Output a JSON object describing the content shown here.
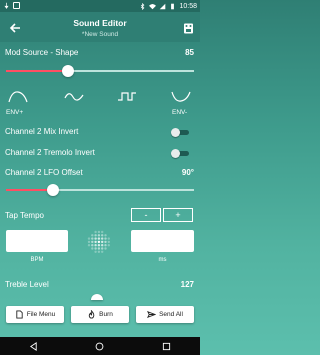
{
  "status_bar": {
    "time": "10:58"
  },
  "header": {
    "title": "Sound Editor",
    "subtitle": "*New Sound",
    "back_icon": "arrow-left-icon",
    "app_icon": "pedal-icon"
  },
  "mod_source": {
    "label": "Mod Source - Shape",
    "value": "85",
    "slider_fraction": 0.33
  },
  "waveforms": [
    {
      "name": "envelope-up-icon",
      "label": "ENV+"
    },
    {
      "name": "sine-wave-icon",
      "label": ""
    },
    {
      "name": "square-wave-icon",
      "label": ""
    },
    {
      "name": "envelope-down-icon",
      "label": "ENV-"
    }
  ],
  "toggles": [
    {
      "label": "Channel 2 Mix Invert",
      "on": false
    },
    {
      "label": "Channel 2 Tremolo Invert",
      "on": false
    }
  ],
  "lfo_offset": {
    "label": "Channel 2 LFO Offset",
    "value": "90°",
    "slider_fraction": 0.25
  },
  "tap_tempo": {
    "label": "Tap Tempo",
    "minus_label": "-",
    "plus_label": "+",
    "bpm_value": "",
    "bpm_label": "BPM",
    "ms_value": "",
    "ms_label": "ms",
    "tap_icon": "tap-dots-icon"
  },
  "treble": {
    "label": "Treble Level",
    "value": "127"
  },
  "bottom_buttons": [
    {
      "label": "File Menu",
      "icon": "file-icon"
    },
    {
      "label": "Burn",
      "icon": "flame-icon"
    },
    {
      "label": "Send All",
      "icon": "send-icon"
    }
  ],
  "colors": {
    "accent": "#ff4e63",
    "header": "#2f7f74",
    "toggle_off": "#1e5a52"
  }
}
